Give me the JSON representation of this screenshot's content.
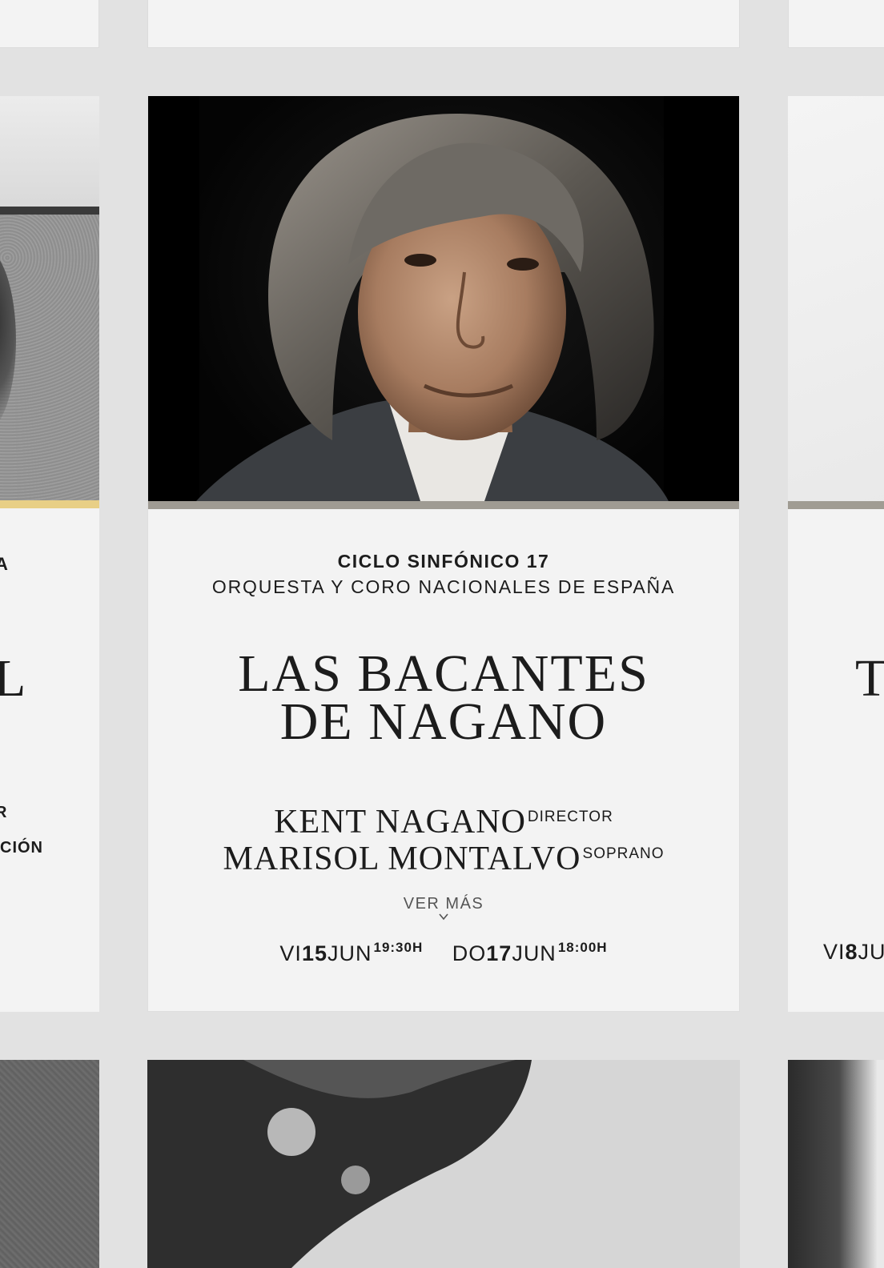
{
  "left_card": {
    "frag_cycle": "A",
    "frag_title": "L",
    "frag_line1": "R",
    "frag_line2": "CIÓN"
  },
  "featured": {
    "cycle": "CICLO SINFÓNICO 17",
    "ensemble": "ORQUESTA Y CORO NACIONALES DE ESPAÑA",
    "title_line1": "LAS BACANTES",
    "title_line2": "DE NAGANO",
    "performers": [
      {
        "name": "KENT NAGANO",
        "role": "DIRECTOR"
      },
      {
        "name": "MARISOL MONTALVO",
        "role": "SOPRANO"
      }
    ],
    "more_label": "VER MÁS",
    "dates": [
      {
        "day": "VI",
        "num": "15",
        "month": "JUN",
        "time": "19:30H"
      },
      {
        "day": "DO",
        "num": "17",
        "month": "JUN",
        "time": "18:00H"
      }
    ],
    "accent_color": "#9f9b93"
  },
  "right_card": {
    "frag_title": "T",
    "frag_day": "VI",
    "frag_num": "8",
    "frag_month": "JU"
  },
  "colors": {
    "background": "#e2e2e2",
    "card": "#f3f3f3",
    "left_accent": "#e8cf86"
  }
}
